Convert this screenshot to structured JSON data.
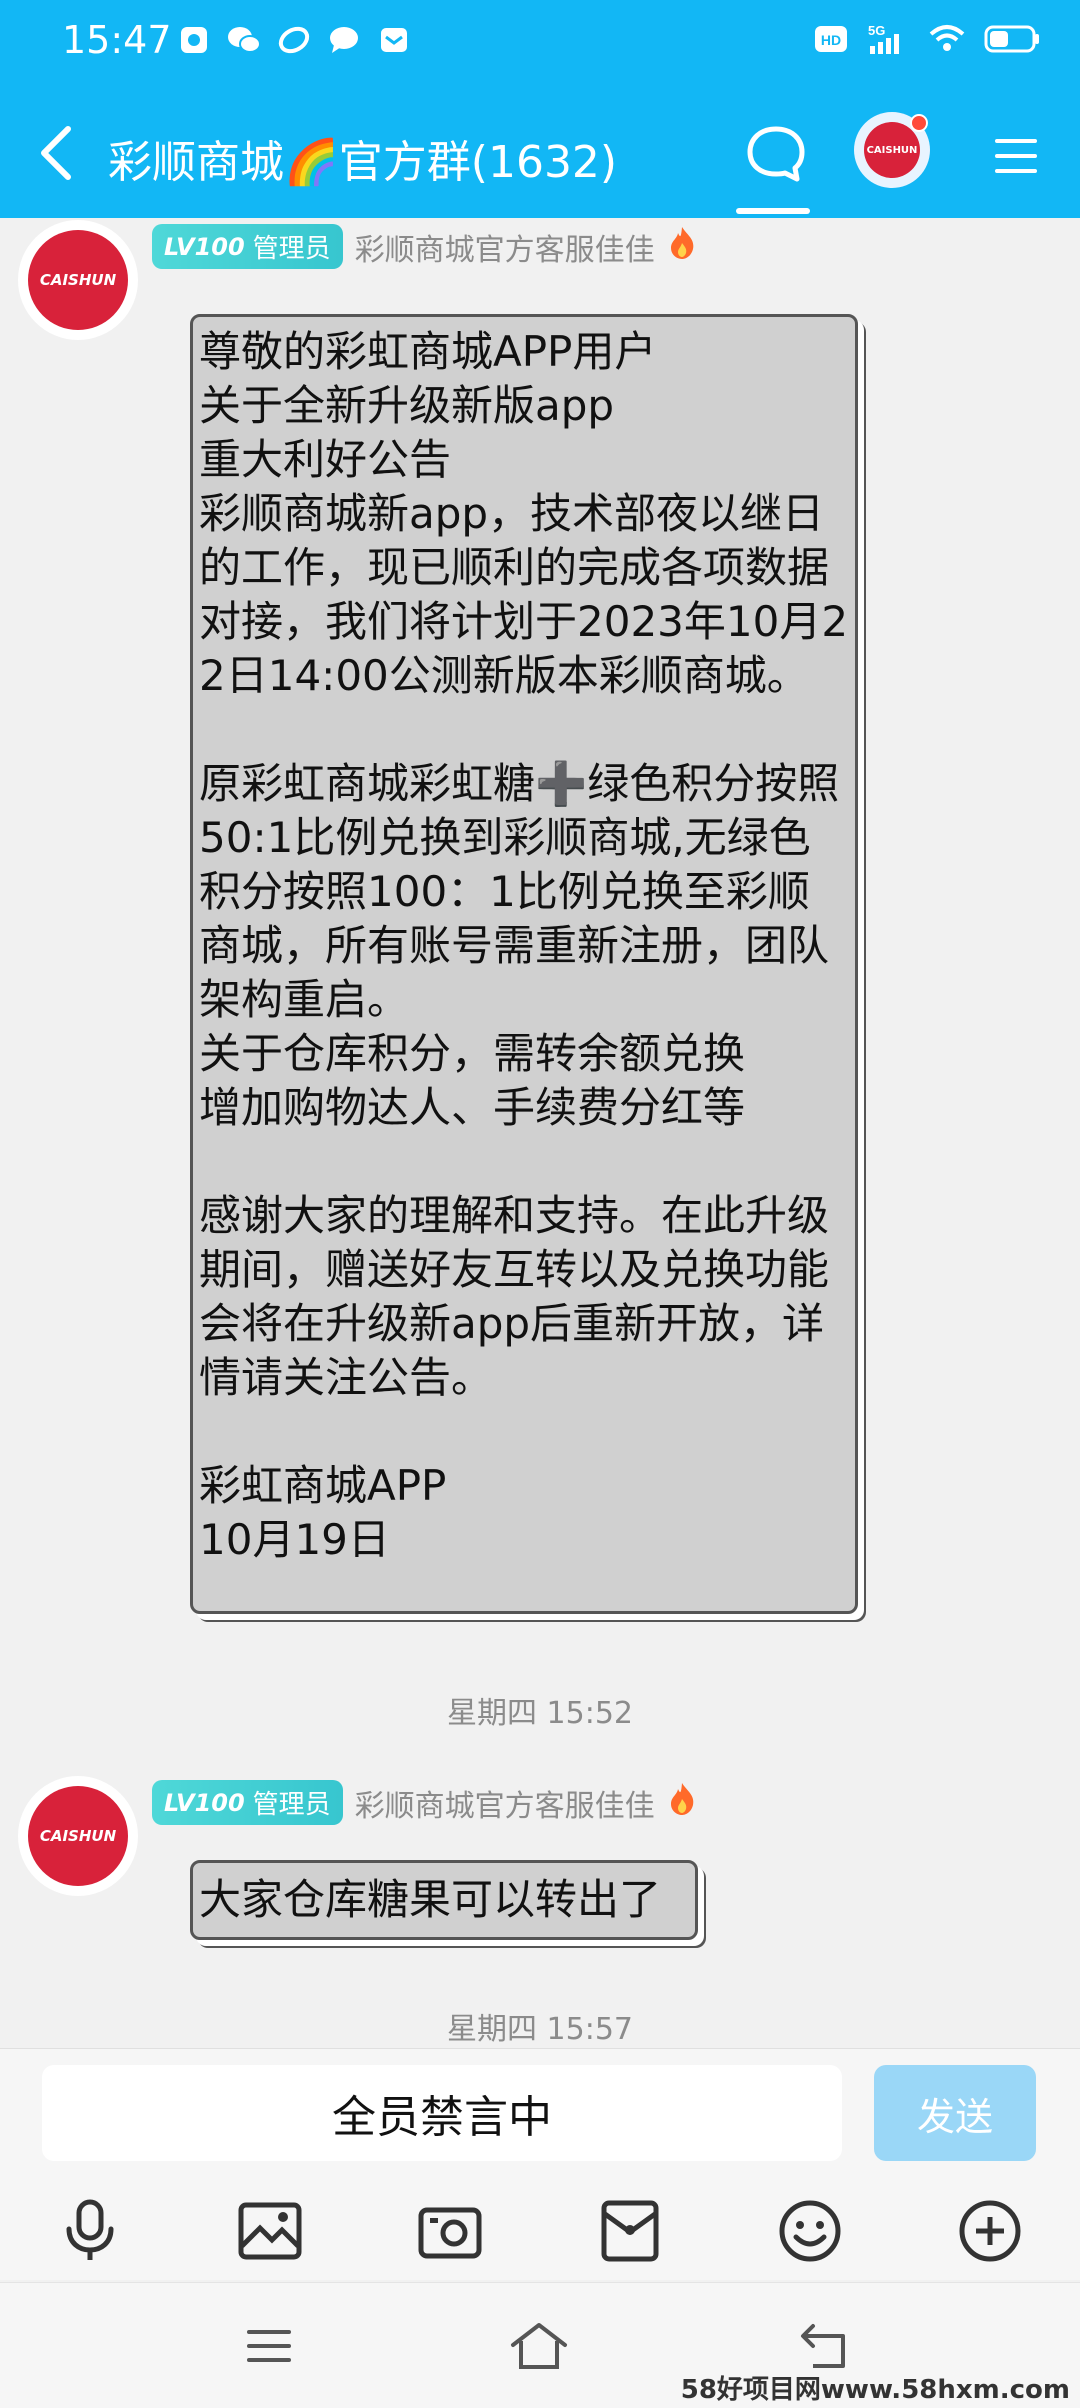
{
  "status_bar": {
    "time": "15:47",
    "network": "5G",
    "hd_label": "HD"
  },
  "header": {
    "title": "彩顺商城🌈官方群(1632)",
    "group_avatar_text": "CAISHUN",
    "accent_color": "#12b7f5"
  },
  "messages": [
    {
      "avatar_text": "CAISHUN",
      "level": "LV100",
      "role": "管理员",
      "sender": "彩顺商城官方客服佳佳",
      "text": "尊敬的彩虹商城APP用户\n关于全新升级新版app\n重大利好公告\n彩顺商城新app，技术部夜以继日的工作，现已顺利的完成各项数据对接，我们将计划于2023年10月22日14:00公测新版本彩顺商城。\n\n原彩虹商城彩虹糖➕绿色积分按照50:1比例兑换到彩顺商城,无绿色积分按照100：1比例兑换至彩顺商城，所有账号需重新注册，团队架构重启。\n关于仓库积分，需转余额兑换\n增加购物达人、手续费分红等\n\n感谢大家的理解和支持。在此升级期间，赠送好友互转以及兑换功能会将在升级新app后重新开放，详情请关注公告。\n\n彩虹商城APP\n10月19日"
    },
    {
      "avatar_text": "CAISHUN",
      "level": "LV100",
      "role": "管理员",
      "sender": "彩顺商城官方客服佳佳",
      "text": "大家仓库糖果可以转出了"
    }
  ],
  "timestamps": [
    "星期四 15:52",
    "星期四 15:57"
  ],
  "input": {
    "muted_text": "全员禁言中",
    "send_label": "发送"
  },
  "watermark": "58好项目网www.58hxm.com"
}
